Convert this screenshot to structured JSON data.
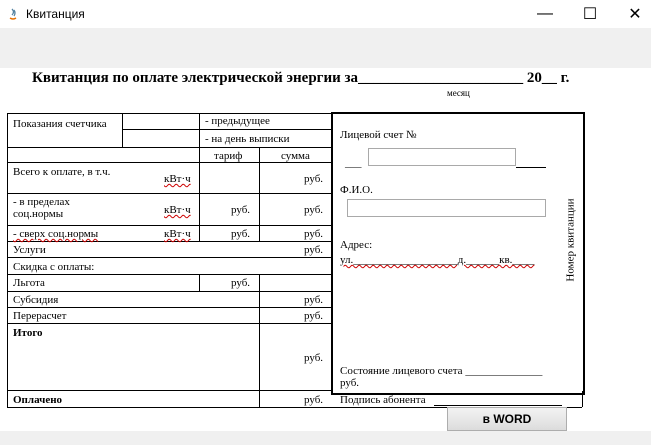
{
  "window": {
    "title": "Квитанция",
    "minimize": "—",
    "maximize": "☐",
    "close": "✕"
  },
  "heading": {
    "text": "Квитанция по оплате электрической энергии за",
    "blank": "______________________",
    "year": "20__ г.",
    "month_hint": "месяц"
  },
  "meter": {
    "label": "Показания счетчика",
    "previous": "- предыдущее",
    "current": "- на день выписки",
    "col_tariff": "тариф",
    "col_sum": "сумма"
  },
  "rows": {
    "total_pay": "Всего к оплате, в т.ч.",
    "within_norm": "- в пределах соц.нормы",
    "over_norm": "- сверх соц.нормы",
    "services": "Услуги",
    "discount": "Скидка с оплаты:",
    "benefit": "Льгота",
    "subsidy": "Субсидия",
    "recalc": "Перерасчет",
    "total": "Итого",
    "paid": "Оплачено"
  },
  "units": {
    "kwh": "кВт·ч",
    "rub": "руб."
  },
  "right_panel": {
    "account_label": "Лицевой счет №",
    "account_prefix": "___",
    "account_value": "",
    "fio_label": "Ф.И.О.",
    "fio_value": "",
    "address_label": "Адрес:",
    "address_line": "ул.___________________д.______кв.____",
    "state_label": "Состояние лицевого счета ______________",
    "state_unit": "руб.",
    "vertical": "Номер квитанции",
    "signature": "Подпись абонента"
  },
  "buttons": {
    "word": "в WORD"
  }
}
